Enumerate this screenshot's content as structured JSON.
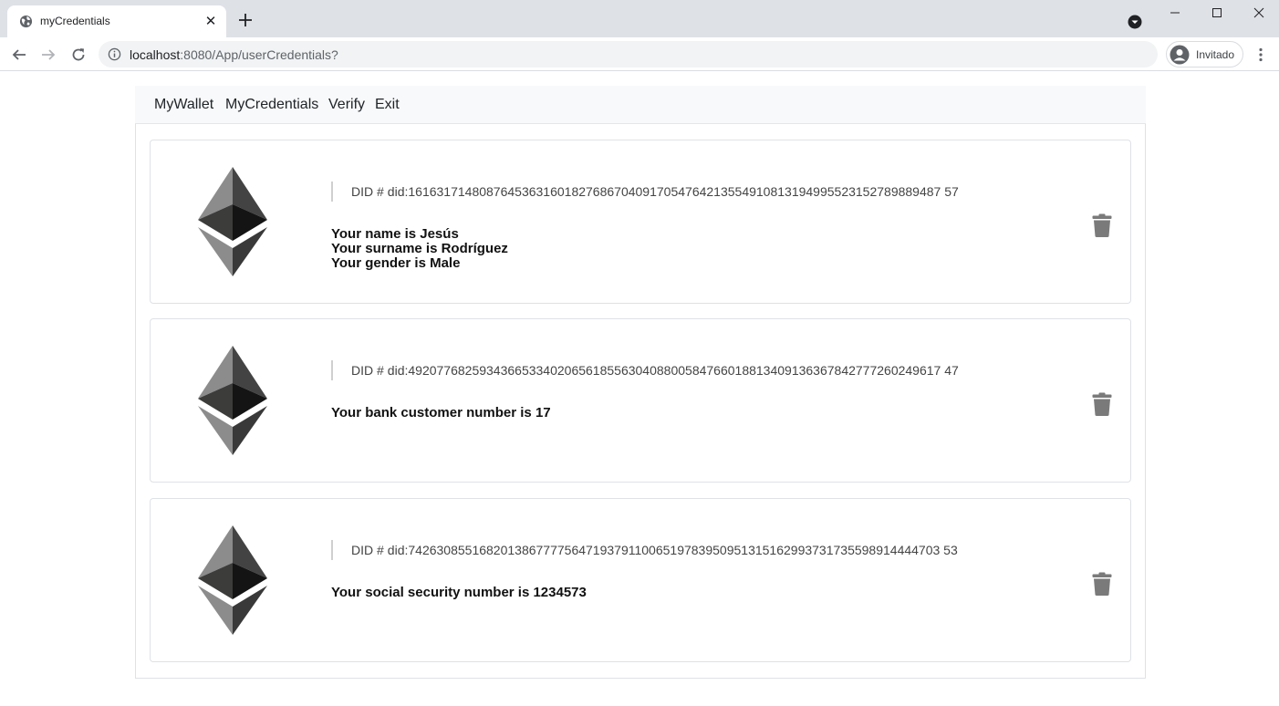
{
  "browser": {
    "tab_title": "myCredentials",
    "tab_close_glyph": "✕",
    "url_host": "localhost",
    "url_rest": ":8080/App/userCredentials?",
    "profile_label": "Invitado"
  },
  "app_nav": {
    "items": [
      "MyWallet",
      "MyCredentials",
      "Verify",
      "Exit"
    ]
  },
  "did_prefix": "DID #",
  "credentials": [
    {
      "did": "did:161631714808764536316018276867040917054764213554910813194995523152789889487 57",
      "attributes": [
        "Your name is Jesús",
        "Your surname is Rodríguez",
        "Your gender is Male"
      ]
    },
    {
      "did": "did:492077682593436653340206561855630408800584766018813409136367842777260249617 47",
      "attributes": [
        "Your bank customer number is 17"
      ]
    },
    {
      "did": "did:742630855168201386777756471937911006519783950951315162993731735598914444703 53",
      "attributes": [
        "Your social security number is 1234573"
      ]
    }
  ],
  "colors": {
    "tabstrip": "#dee1e6",
    "navbar_bg": "#f8f9fa",
    "icon_gray": "#7a7a7a"
  },
  "icons": [
    "globe-icon",
    "close-icon",
    "plus-icon",
    "search-tabs-icon",
    "minimize-icon",
    "maximize-icon",
    "window-close-icon",
    "back-arrow-icon",
    "forward-arrow-icon",
    "reload-icon",
    "info-icon",
    "avatar-icon",
    "kebab-menu-icon",
    "ethereum-icon",
    "trash-icon"
  ]
}
